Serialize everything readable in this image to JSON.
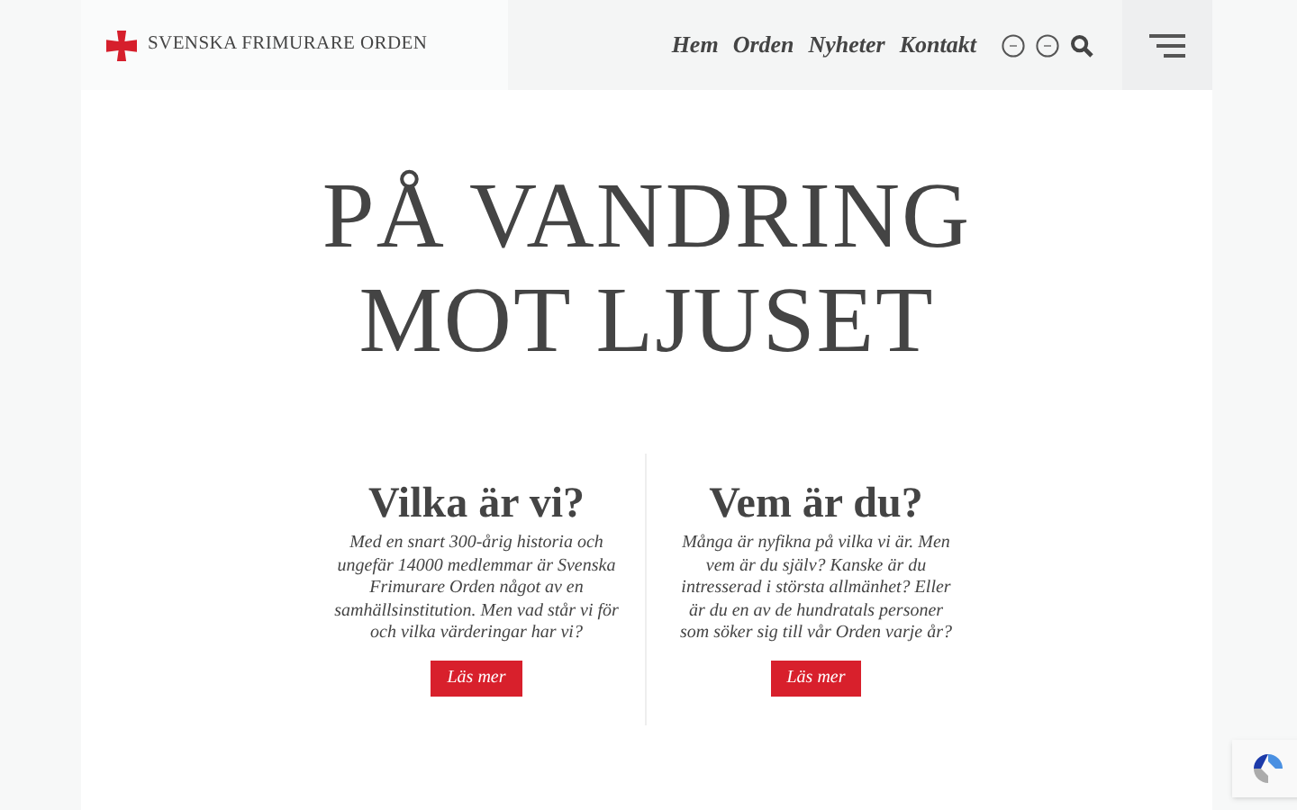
{
  "header": {
    "logo_text": "SVENSKA FRIMURARE ORDEN",
    "nav": [
      {
        "label": "Hem"
      },
      {
        "label": "Orden"
      },
      {
        "label": "Nyheter"
      },
      {
        "label": "Kontakt"
      }
    ]
  },
  "hero": {
    "title_lines": [
      "PÅ VANDRING",
      "MOT LJUSET"
    ]
  },
  "columns": [
    {
      "heading": "Vilka är vi?",
      "text": "Med en snart 300-årig historia och ungefär 14000 medlemmar är Svenska Frimurare Orden något av en samhällsinstitution. Men vad står vi för och vilka värderingar har vi?",
      "button": "Läs mer"
    },
    {
      "heading": "Vem är du?",
      "text": "Många är nyfikna på vilka vi är. Men vem är du själv? Kanske är du intresserad i största allmänhet? Eller är du en av de hundratals personer som söker sig till vår Orden varje år?",
      "button": "Läs mer"
    }
  ]
}
